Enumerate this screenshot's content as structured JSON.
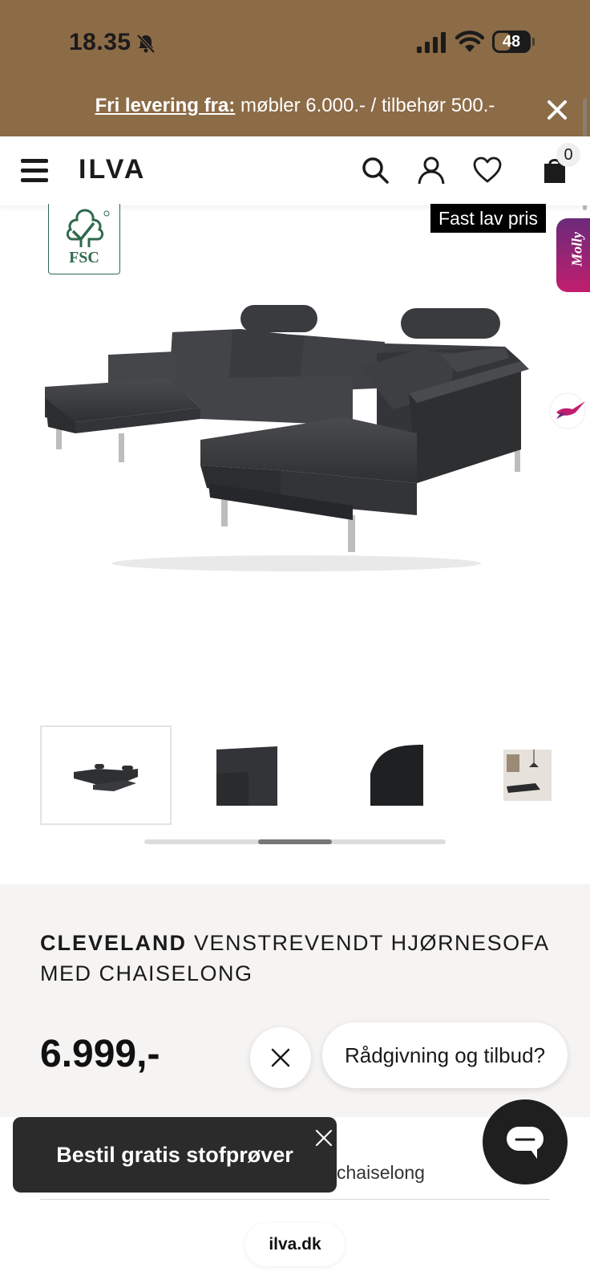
{
  "status_bar": {
    "time": "18.35",
    "battery": "48",
    "battery_level": 0.48
  },
  "promo": {
    "link": "Fri levering fra:",
    "text": " møbler 6.000.- / tilbehør 500.-"
  },
  "header": {
    "logo": "ILVA",
    "cart_count": "0",
    "icons": [
      "menu-icon",
      "search-icon",
      "account-icon",
      "heart-icon",
      "cart-icon"
    ]
  },
  "hero": {
    "badge_fsc": "FSC",
    "price_tag": "Fast lav pris",
    "molly_tab": "Molly"
  },
  "product": {
    "brand": "CLEVELAND",
    "title": " VENSTREVENDT HJØRNESOFA MED CHAISELONG",
    "price": "6.999,-",
    "variant_partial": "chaiselong"
  },
  "gallery": {
    "selected_index": 0,
    "scroll_position": 0.5
  },
  "chat": {
    "bubble": "Rådgivning og tilbud?"
  },
  "toast": {
    "label": "Bestil gratis stofprøver"
  },
  "browser": {
    "url": "ilva.dk"
  },
  "colors": {
    "brand_brown": "#8c6b47",
    "sofa_gray": "#3a3b3d",
    "info_bg": "#f5f4f2",
    "fsc_green": "#2f6a4c"
  }
}
